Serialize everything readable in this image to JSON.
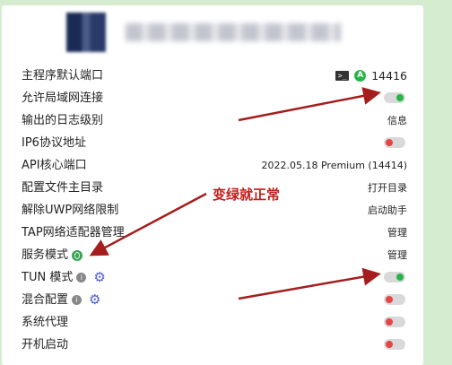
{
  "settings": {
    "rows": [
      {
        "label": "主程序默认端口",
        "value": "14416",
        "term_icon_text": ">_",
        "badge": "A"
      },
      {
        "label": "允许局域网连接"
      },
      {
        "label": "输出的日志级别",
        "value": "信息"
      },
      {
        "label": "IP6协议地址"
      },
      {
        "label": "API核心端口",
        "value": "2022.05.18 Premium (14414)"
      },
      {
        "label": "配置文件主目录",
        "value": "打开目录"
      },
      {
        "label": "解除UWP网络限制",
        "value": "启动助手"
      },
      {
        "label": "TAP网络适配器管理",
        "value": "管理"
      },
      {
        "label": "服务模式",
        "value": "管理"
      },
      {
        "label": "TUN 模式"
      },
      {
        "label": "混合配置"
      },
      {
        "label": "系统代理"
      },
      {
        "label": "开机启动"
      }
    ],
    "toggles": {
      "allow_lan": "on",
      "ipv6": "off",
      "tun_mode": "on",
      "mixin": "off",
      "system_proxy": "off",
      "autostart": "off"
    }
  },
  "annotation": {
    "text": "变绿就正常",
    "color": "#c41a1a"
  },
  "icons": {
    "info": "i",
    "gear": "⚙"
  },
  "colors": {
    "background": "#d6ecd0",
    "toggle_on": "#27b548",
    "toggle_off": "#e64545",
    "accent_gear": "#4a5bd1"
  }
}
